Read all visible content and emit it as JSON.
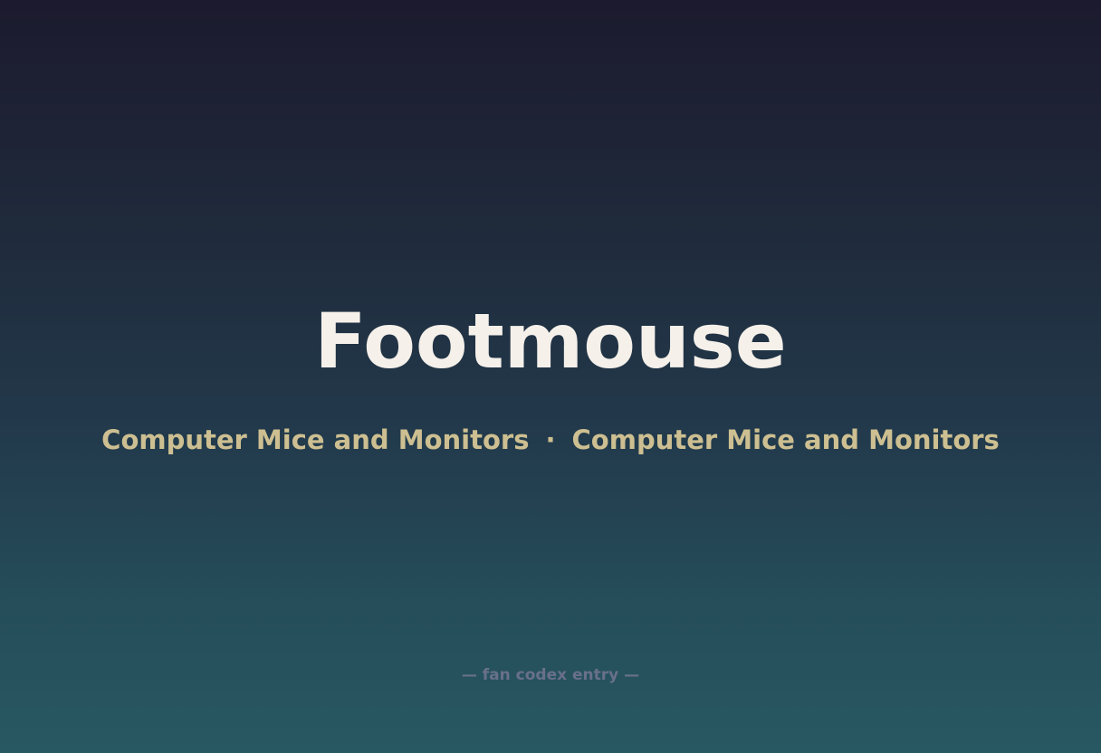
{
  "title": "Footmouse",
  "subtitle": {
    "left": "Computer Mice and Monitors",
    "separator": "·",
    "right": "Computer Mice and Monitors"
  },
  "footer": "— fan codex entry —",
  "colors": {
    "title": "#f5f0ea",
    "subtitle": "#cdbf91",
    "footer": "#69708a",
    "background_top": "#1c1a2e",
    "background_bottom": "#285862"
  }
}
